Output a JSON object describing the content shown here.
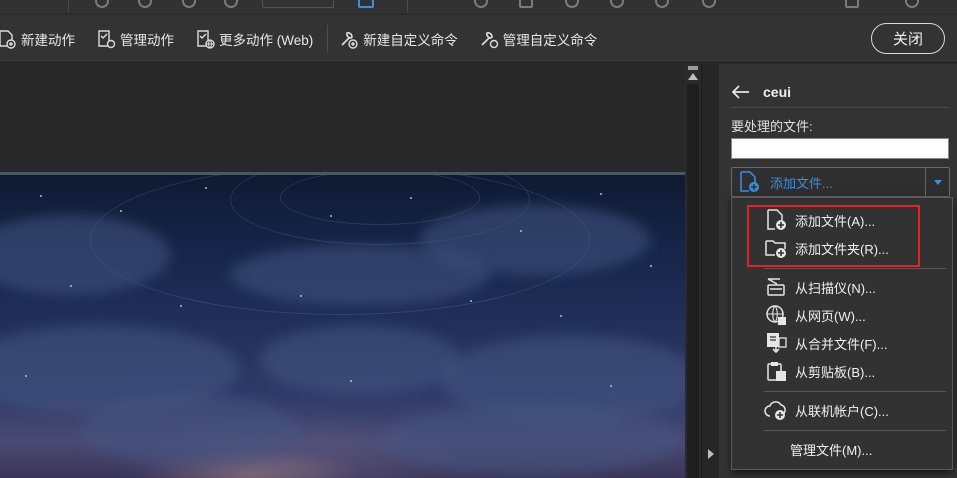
{
  "toolbar": {
    "new_action": "新建动作",
    "manage_actions": "管理动作",
    "more_actions": "更多动作 (Web)",
    "new_custom_command": "新建自定义命令",
    "manage_custom_commands": "管理自定义命令",
    "close": "关闭"
  },
  "panel": {
    "title": "ceui",
    "files_label": "要处理的文件:",
    "files_input_value": "",
    "add_files_button": "添加文件..."
  },
  "menu": {
    "items": [
      {
        "label": "添加文件(A)...",
        "icon": "add-file-icon"
      },
      {
        "label": "添加文件夹(R)...",
        "icon": "add-folder-icon"
      },
      {
        "label": "从扫描仪(N)...",
        "icon": "scanner-icon"
      },
      {
        "label": "从网页(W)...",
        "icon": "web-page-icon"
      },
      {
        "label": "从合并文件(F)...",
        "icon": "combine-files-icon"
      },
      {
        "label": "从剪贴板(B)...",
        "icon": "clipboard-icon"
      },
      {
        "label": "从联机帐户(C)...",
        "icon": "cloud-account-icon"
      },
      {
        "label": "管理文件(M)...",
        "icon": ""
      }
    ]
  },
  "colors": {
    "accent": "#3a8ee6",
    "highlight": "#e0242a",
    "panel_bg": "#333333"
  }
}
